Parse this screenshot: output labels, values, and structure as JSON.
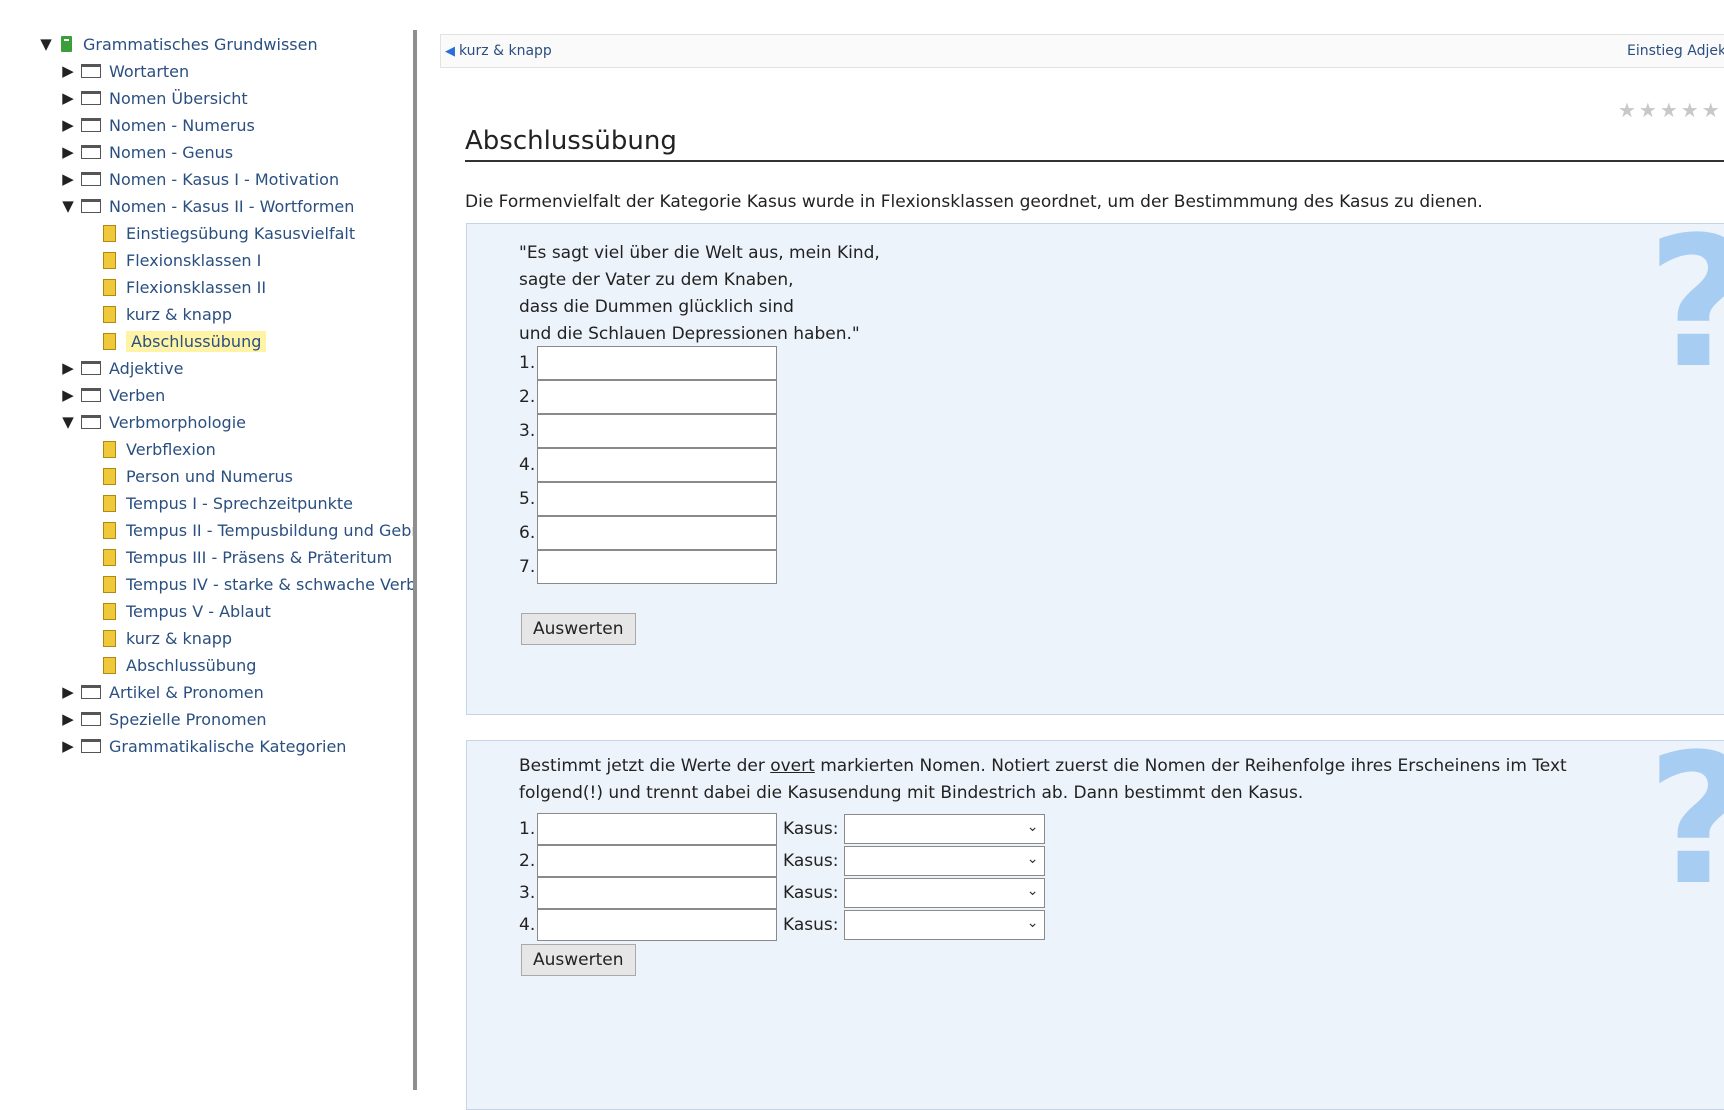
{
  "tree": {
    "root_label": "Grammatisches Grundwissen",
    "items": [
      {
        "label": "Wortarten",
        "type": "folder",
        "expanded": false
      },
      {
        "label": "Nomen Übersicht",
        "type": "folder",
        "expanded": false
      },
      {
        "label": "Nomen - Numerus",
        "type": "folder",
        "expanded": false
      },
      {
        "label": "Nomen - Genus",
        "type": "folder",
        "expanded": false
      },
      {
        "label": "Nomen - Kasus I - Motivation",
        "type": "folder",
        "expanded": false
      },
      {
        "label": "Nomen - Kasus II - Wortformen",
        "type": "folder",
        "expanded": true
      },
      {
        "label": "Einstiegsübung Kasusvielfalt",
        "type": "page"
      },
      {
        "label": "Flexionsklassen I",
        "type": "page"
      },
      {
        "label": "Flexionsklassen II",
        "type": "page"
      },
      {
        "label": "kurz & knapp",
        "type": "page"
      },
      {
        "label": "Abschlussübung",
        "type": "page",
        "selected": true
      },
      {
        "label": "Adjektive",
        "type": "folder",
        "expanded": false
      },
      {
        "label": "Verben",
        "type": "folder",
        "expanded": false
      },
      {
        "label": "Verbmorphologie",
        "type": "folder",
        "expanded": true
      },
      {
        "label": "Verbflexion",
        "type": "page"
      },
      {
        "label": "Person und Numerus",
        "type": "page"
      },
      {
        "label": "Tempus I - Sprechzeitpunkte",
        "type": "page"
      },
      {
        "label": "Tempus II - Tempusbildung und Gebr",
        "type": "page"
      },
      {
        "label": "Tempus III - Präsens & Präteritum",
        "type": "page"
      },
      {
        "label": "Tempus IV - starke & schwache Verbe",
        "type": "page"
      },
      {
        "label": "Tempus V - Ablaut",
        "type": "page"
      },
      {
        "label": "kurz & knapp",
        "type": "page"
      },
      {
        "label": "Abschlussübung",
        "type": "page"
      },
      {
        "label": "Artikel & Pronomen",
        "type": "folder",
        "expanded": false
      },
      {
        "label": "Spezielle Pronomen",
        "type": "folder",
        "expanded": false
      },
      {
        "label": "Grammatikalische Kategorien",
        "type": "folder",
        "expanded": false
      }
    ]
  },
  "nav": {
    "prev_label": "kurz & knapp",
    "next_label": "Einstieg Adjekt"
  },
  "page": {
    "title": "Abschlussübung",
    "intro": "Die Formenvielfalt der Kategorie Kasus wurde in Flexionsklassen geordnet, um der Bestimmmung des Kasus zu dienen."
  },
  "question1": {
    "poem": [
      "\"Es sagt viel über die Welt aus, mein Kind,",
      "sagte der Vater zu dem Knaben,",
      "dass die Dummen glücklich sind",
      "und die Schlauen Depressionen haben.\""
    ],
    "numbers": [
      "1.",
      "2.",
      "3.",
      "4.",
      "5.",
      "6.",
      "7."
    ],
    "button_label": "Auswerten"
  },
  "question2": {
    "text_before": "Bestimmt jetzt die Werte der ",
    "text_underlined": "overt",
    "text_after": " markierten Nomen. Notiert zuerst die Nomen der Reihenfolge ihres Erscheinens im Text folgend(!) und trennt dabei die Kasusendung mit Bindestrich ab. Dann bestimmt den Kasus.",
    "numbers": [
      "1.",
      "2.",
      "3.",
      "4."
    ],
    "kasus_label": "Kasus:",
    "button_label": "Auswerten"
  },
  "qmark_symbol": "?",
  "stars": "★★★★★"
}
